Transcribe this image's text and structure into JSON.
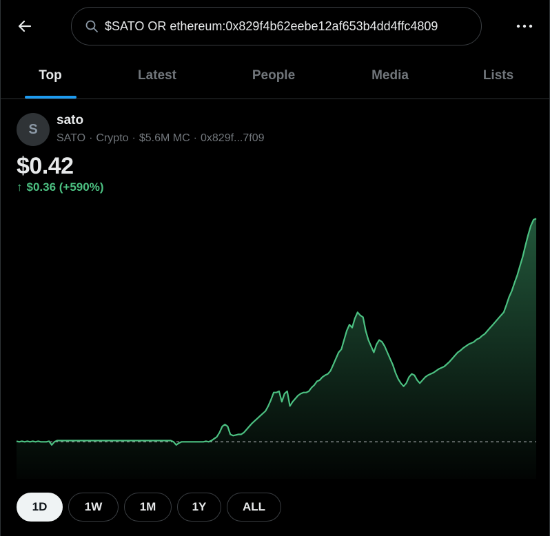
{
  "search": {
    "query": "$SATO OR ethereum:0x829f4b62eebe12af653b4dd4ffc4809",
    "icon": "search-icon"
  },
  "tabs": [
    {
      "label": "Top",
      "active": true
    },
    {
      "label": "Latest",
      "active": false
    },
    {
      "label": "People",
      "active": false
    },
    {
      "label": "Media",
      "active": false
    },
    {
      "label": "Lists",
      "active": false
    }
  ],
  "token": {
    "avatar_letter": "S",
    "name": "sato",
    "symbol": "SATO",
    "category": "Crypto",
    "market_cap": "$5.6M MC",
    "address": "0x829f...7f09",
    "price": "$0.42",
    "change_arrow": "↑",
    "change": "$0.36 (+590%)"
  },
  "ranges": [
    {
      "label": "1D",
      "active": true
    },
    {
      "label": "1W",
      "active": false
    },
    {
      "label": "1M",
      "active": false
    },
    {
      "label": "1Y",
      "active": false
    },
    {
      "label": "ALL",
      "active": false
    }
  ],
  "colors": {
    "accent": "#1d9bf0",
    "positive": "#4cc182",
    "background": "#000000"
  },
  "chart_data": {
    "type": "area",
    "baseline": 0.06,
    "ylim": [
      0.0,
      0.43
    ],
    "values": [
      0.061,
      0.06,
      0.061,
      0.06,
      0.061,
      0.06,
      0.061,
      0.06,
      0.061,
      0.06,
      0.06,
      0.06,
      0.061,
      0.055,
      0.06,
      0.062,
      0.062,
      0.062,
      0.062,
      0.062,
      0.062,
      0.062,
      0.062,
      0.062,
      0.062,
      0.062,
      0.062,
      0.062,
      0.062,
      0.062,
      0.062,
      0.062,
      0.062,
      0.062,
      0.062,
      0.062,
      0.062,
      0.062,
      0.062,
      0.062,
      0.062,
      0.062,
      0.062,
      0.062,
      0.062,
      0.062,
      0.062,
      0.062,
      0.062,
      0.062,
      0.062,
      0.062,
      0.062,
      0.062,
      0.062,
      0.062,
      0.062,
      0.062,
      0.06,
      0.055,
      0.058,
      0.06,
      0.06,
      0.06,
      0.06,
      0.06,
      0.06,
      0.06,
      0.06,
      0.06,
      0.061,
      0.06,
      0.062,
      0.065,
      0.068,
      0.075,
      0.085,
      0.088,
      0.085,
      0.072,
      0.07,
      0.071,
      0.072,
      0.072,
      0.075,
      0.08,
      0.085,
      0.09,
      0.094,
      0.098,
      0.102,
      0.106,
      0.11,
      0.118,
      0.128,
      0.14,
      0.14,
      0.142,
      0.125,
      0.138,
      0.142,
      0.118,
      0.125,
      0.13,
      0.135,
      0.138,
      0.14,
      0.14,
      0.142,
      0.148,
      0.152,
      0.158,
      0.16,
      0.165,
      0.168,
      0.17,
      0.175,
      0.185,
      0.195,
      0.205,
      0.21,
      0.225,
      0.24,
      0.25,
      0.245,
      0.26,
      0.27,
      0.265,
      0.262,
      0.24,
      0.225,
      0.215,
      0.205,
      0.218,
      0.225,
      0.222,
      0.215,
      0.205,
      0.195,
      0.185,
      0.172,
      0.162,
      0.155,
      0.15,
      0.155,
      0.165,
      0.17,
      0.168,
      0.16,
      0.155,
      0.16,
      0.165,
      0.168,
      0.17,
      0.172,
      0.175,
      0.178,
      0.18,
      0.182,
      0.186,
      0.19,
      0.195,
      0.2,
      0.205,
      0.208,
      0.212,
      0.215,
      0.218,
      0.22,
      0.222,
      0.226,
      0.228,
      0.232,
      0.235,
      0.24,
      0.245,
      0.25,
      0.255,
      0.26,
      0.265,
      0.27,
      0.282,
      0.295,
      0.305,
      0.318,
      0.33,
      0.345,
      0.36,
      0.378,
      0.395,
      0.41,
      0.42,
      0.422
    ]
  }
}
